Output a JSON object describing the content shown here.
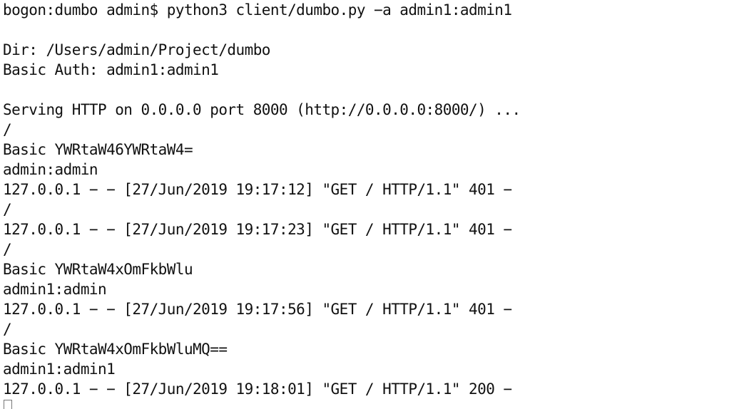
{
  "terminal": {
    "lines": [
      "bogon:dumbo admin$ python3 client/dumbo.py −a admin1:admin1",
      "",
      "Dir: /Users/admin/Project/dumbo",
      "Basic Auth: admin1:admin1",
      "",
      "Serving HTTP on 0.0.0.0 port 8000 (http://0.0.0.0:8000/) ...",
      "/",
      "Basic YWRtaW46YWRtaW4=",
      "admin:admin",
      "127.0.0.1 − − [27/Jun/2019 19:17:12] \"GET / HTTP/1.1\" 401 −",
      "/",
      "127.0.0.1 − − [27/Jun/2019 19:17:23] \"GET / HTTP/1.1\" 401 −",
      "/",
      "Basic YWRtaW4xOmFkbWlu",
      "admin1:admin",
      "127.0.0.1 − − [27/Jun/2019 19:17:56] \"GET / HTTP/1.1\" 401 −",
      "/",
      "Basic YWRtaW4xOmFkbWluMQ==",
      "admin1:admin1",
      "127.0.0.1 − − [27/Jun/2019 19:18:01] \"GET / HTTP/1.1\" 200 −"
    ]
  }
}
